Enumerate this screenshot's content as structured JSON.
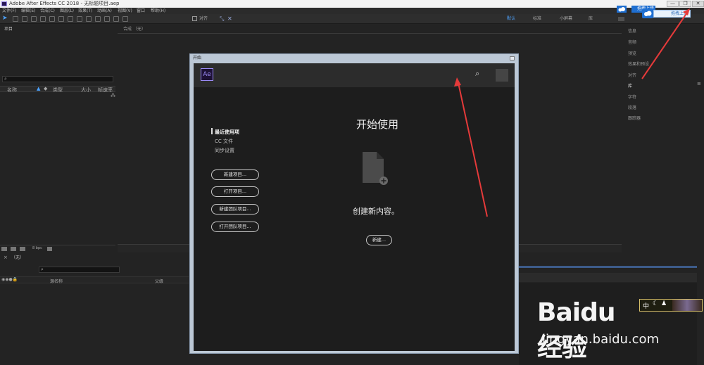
{
  "window": {
    "title": "Adobe After Effects CC 2018 - 无标题项目.aep",
    "min_label": "—",
    "max_label": "❐",
    "close_label": "✕"
  },
  "menu": [
    "文件(F)",
    "编辑(E)",
    "合成(C)",
    "图层(L)",
    "效果(T)",
    "动画(A)",
    "视图(V)",
    "窗口",
    "帮助(H)"
  ],
  "toolbar": {
    "align_label": "对齐",
    "workspaces": [
      "默认",
      "标准",
      "小屏幕",
      "库"
    ]
  },
  "project_panel": {
    "title": "项目",
    "columns": [
      "名称",
      "类型",
      "大小",
      "帧速率"
    ],
    "bpc": "8 bpc"
  },
  "comp_panel": {
    "title": "合成 （无）"
  },
  "right_panel": {
    "items": [
      "信息",
      "音频",
      "预览",
      "效果和预设",
      "对齐",
      "库",
      "字符",
      "段落",
      "跟踪器"
    ]
  },
  "timeline": {
    "title": "（无）",
    "columns": [
      "源名称",
      "父级"
    ]
  },
  "dialog": {
    "title": "开始",
    "logo": "Ae",
    "heading": "开始使用",
    "nav": [
      "最近使用项",
      "CC 文件",
      "同步设置"
    ],
    "buttons": [
      "新建项目...",
      "打开项目...",
      "新建团队项目...",
      "打开团队项目..."
    ],
    "empty_text": "创建新内容。",
    "new_button": "新建..."
  },
  "overlay": {
    "upload_button": "拖拽上传",
    "upload_button2": "拖拽上传",
    "watermark_brand": "Baidu经验",
    "watermark_url": "jingyan.baidu.com",
    "badge_text": "中"
  },
  "colors": {
    "accent": "#4da3ff",
    "annotation_arrow": "#e53a3a",
    "ae_purple": "#9b8bf5"
  }
}
